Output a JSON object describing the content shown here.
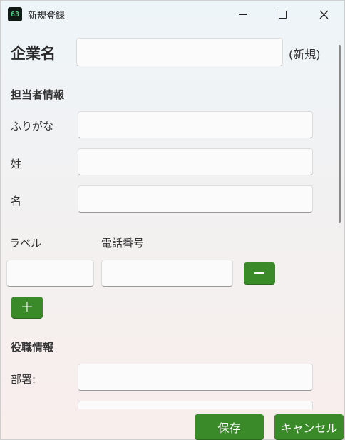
{
  "window": {
    "title": "新規登録",
    "icon_text": "63"
  },
  "company": {
    "label": "企業名",
    "value": "",
    "note": "(新規)"
  },
  "contact_section": {
    "title": "担当者情報",
    "furigana_label": "ふりがな",
    "last_name_label": "姓",
    "first_name_label": "名"
  },
  "phone_section": {
    "label_header": "ラベル",
    "phone_header": "電話番号"
  },
  "role_section": {
    "title": "役職情報",
    "department_label": "部署:"
  },
  "footer": {
    "save_label": "保存",
    "cancel_label": "キャンセル"
  },
  "colors": {
    "accent": "#3b8a2a"
  },
  "icons": {
    "minimize": "minimize-icon",
    "maximize": "maximize-icon",
    "close": "close-icon",
    "remove": "minus-icon",
    "add": "plus-icon"
  }
}
